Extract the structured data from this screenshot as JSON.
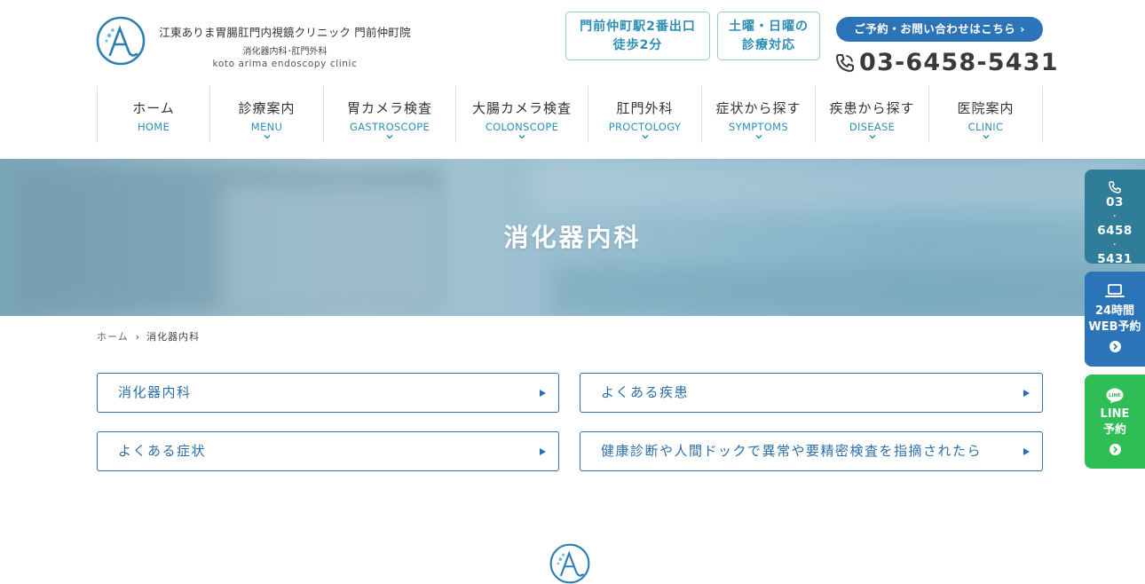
{
  "clinic": {
    "name": "江東ありま胃腸肛門内視鏡クリニック 門前仲町院",
    "sub": "消化器内科･肛門外科",
    "en": "koto arima endoscopy clinic"
  },
  "header": {
    "station": [
      "門前仲町駅2番出口",
      "徒歩2分"
    ],
    "weekend": [
      "土曜・日曜の",
      "診療対応"
    ],
    "reserve_label": "ご予約・お問い合わせはこちら ›",
    "phone": "03-6458-5431"
  },
  "nav": [
    {
      "ja": "ホーム",
      "en": "HOME",
      "dropdown": false
    },
    {
      "ja": "診療案内",
      "en": "MENU",
      "dropdown": true
    },
    {
      "ja": "胃カメラ検査",
      "en": "GASTROSCOPE",
      "dropdown": true
    },
    {
      "ja": "大腸カメラ検査",
      "en": "COLONSCOPE",
      "dropdown": true
    },
    {
      "ja": "肛門外科",
      "en": "PROCTOLOGY",
      "dropdown": true
    },
    {
      "ja": "症状から探す",
      "en": "SYMPTOMS",
      "dropdown": true
    },
    {
      "ja": "疾患から探す",
      "en": "DISEASE",
      "dropdown": true
    },
    {
      "ja": "医院案内",
      "en": "CLINIC",
      "dropdown": true
    }
  ],
  "hero": {
    "title": "消化器内科"
  },
  "breadcrumb": {
    "home": "ホーム",
    "separator": "›",
    "current": "消化器内科"
  },
  "links": [
    "消化器内科",
    "よくある疾患",
    "よくある症状",
    "健康診断や人間ドックで異常や要精密検査を指摘されたら"
  ],
  "side": {
    "tel": [
      "03",
      "6458",
      "5431"
    ],
    "web": [
      "24時間",
      "WEB予約"
    ],
    "line": [
      "LINE",
      "予約"
    ]
  },
  "colors": {
    "accent": "#2e8fb3",
    "primary": "#2c74b8",
    "tel_tab": "#2f7d99",
    "line_tab": "#2fbe55"
  },
  "icons": [
    "clinic-logo",
    "phone-icon",
    "chevron-down-icon",
    "triangle-right-icon",
    "laptop-icon",
    "line-icon",
    "arrow-circle-icon"
  ]
}
